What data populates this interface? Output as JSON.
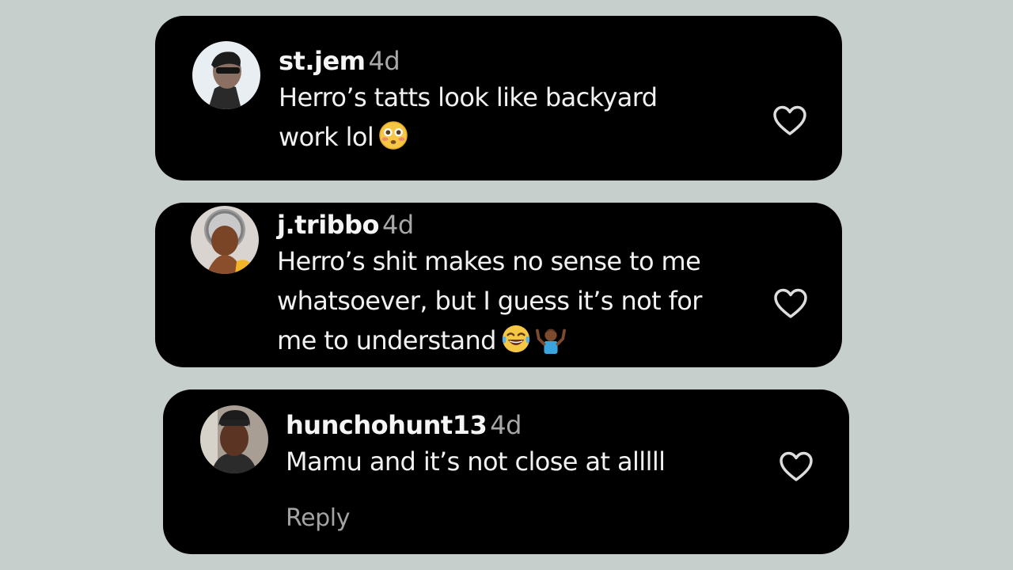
{
  "comments": [
    {
      "username": "st.jem",
      "time": "4d",
      "text_lines": [
        "Herro’s tatts look like backyard",
        "work lol"
      ],
      "emojis": [
        "flushed-face"
      ]
    },
    {
      "username": "j.tribbo",
      "time": "4d",
      "text_lines": [
        "Herro’s shit makes no sense to me",
        "whatsoever, but I guess it’s not for",
        "me to understand"
      ],
      "emojis": [
        "laughing-face",
        "shrugging-person"
      ]
    },
    {
      "username": "hunchohunt13",
      "time": "4d",
      "text_lines": [
        "Mamu and it’s not close at alllll"
      ],
      "reply_label": "Reply"
    }
  ],
  "icons": {
    "like": "heart-outline-icon"
  },
  "colors": {
    "page_background": "#c7cfcc",
    "card_background": "#000000",
    "secondary_text": "#a8a8a8"
  }
}
